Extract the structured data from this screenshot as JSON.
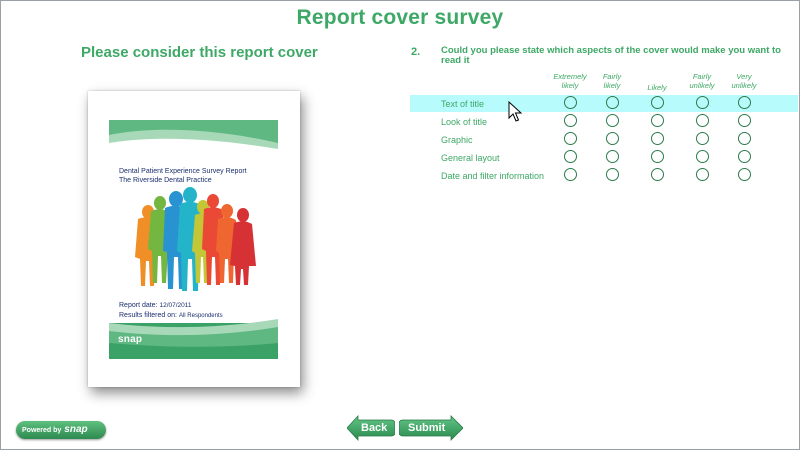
{
  "header": {
    "title": "Report cover survey"
  },
  "left": {
    "heading": "Please consider this report cover",
    "cover": {
      "title_line1": "Dental Patient Experience Survey Report",
      "title_line2": "The Riverside Dental Practice",
      "date_label": "Report date:",
      "date_value": "12/07/2011",
      "filter_label": "Results filtered on:",
      "filter_value": "All Respondents",
      "logo": "snap"
    }
  },
  "question": {
    "number": "2.",
    "text": "Could you please state which aspects of the cover would make you want to read it",
    "columns": [
      {
        "line1": "Extremely",
        "line2": "likely"
      },
      {
        "line1": "Fairly",
        "line2": "likely"
      },
      {
        "line1": "",
        "line2": "Likely"
      },
      {
        "line1": "Fairly",
        "line2": "unlikely"
      },
      {
        "line1": "Very",
        "line2": "unlikely"
      }
    ],
    "rows": [
      {
        "label": "Text of title"
      },
      {
        "label": "Look of title"
      },
      {
        "label": "Graphic"
      },
      {
        "label": "General layout"
      },
      {
        "label": "Date and filter information"
      }
    ]
  },
  "footer": {
    "powered_by": "Powered by",
    "powered_brand": "snap",
    "back_label": "Back",
    "submit_label": "Submit"
  },
  "colors": {
    "accent": "#3ea866",
    "highlight": "#b7fbfd",
    "radio_border": "#2c7a4b"
  },
  "icons": {
    "cursor": "mouse-pointer-icon",
    "back": "arrow-left-icon",
    "submit": "arrow-right-icon"
  }
}
